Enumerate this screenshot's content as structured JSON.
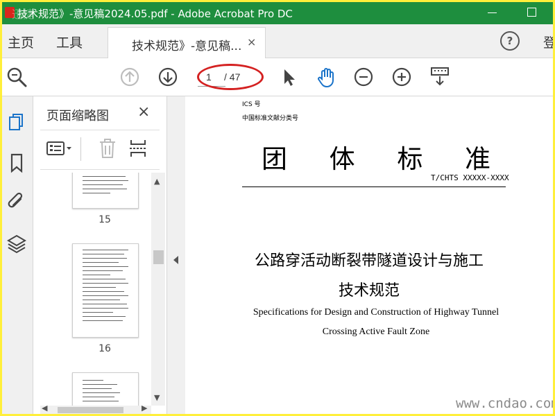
{
  "titlebar": {
    "title": "技术规范》-意见稿2024.05.pdf - Adobe Acrobat Pro DC",
    "watermark": "迅捷"
  },
  "nav": {
    "home": "主页",
    "tools": "工具",
    "login": "登"
  },
  "doc_tab": {
    "label": "技术规范》-意见稿...",
    "close": "×"
  },
  "help": "?",
  "toolbar": {
    "page_current": "1",
    "page_total": "/ 47"
  },
  "thumb_panel": {
    "title": "页面缩略图",
    "close": "×",
    "pages": [
      {
        "label": "15"
      },
      {
        "label": "16"
      },
      {
        "label": ""
      }
    ]
  },
  "document": {
    "ics": "ICS 号",
    "classification": "中国标准文献分类号",
    "big_title": [
      "团",
      "体",
      "标",
      "准"
    ],
    "code": "T/CHTS XXXXX-XXXX",
    "title_cn_1": "公路穿活动断裂带隧道设计与施工",
    "title_cn_2": "技术规范",
    "title_en_1": "Specifications for Design and Construction of Highway Tunnel",
    "title_en_2": "Crossing Active Fault Zone"
  },
  "watermark_site": "www.cndao.com",
  "colors": {
    "titlebar": "#1e8e3e",
    "highlight": "#d42121",
    "hand_tool": "#1a73c9",
    "border_outer": "#ffef3a"
  },
  "icons": {
    "search": "search-icon",
    "prev": "arrow-up-circle-icon",
    "next": "arrow-down-circle-icon",
    "select": "pointer-icon",
    "hand": "hand-icon",
    "zoom_out": "zoom-out-icon",
    "zoom_in": "zoom-in-icon",
    "keyboard": "keyboard-icon"
  }
}
